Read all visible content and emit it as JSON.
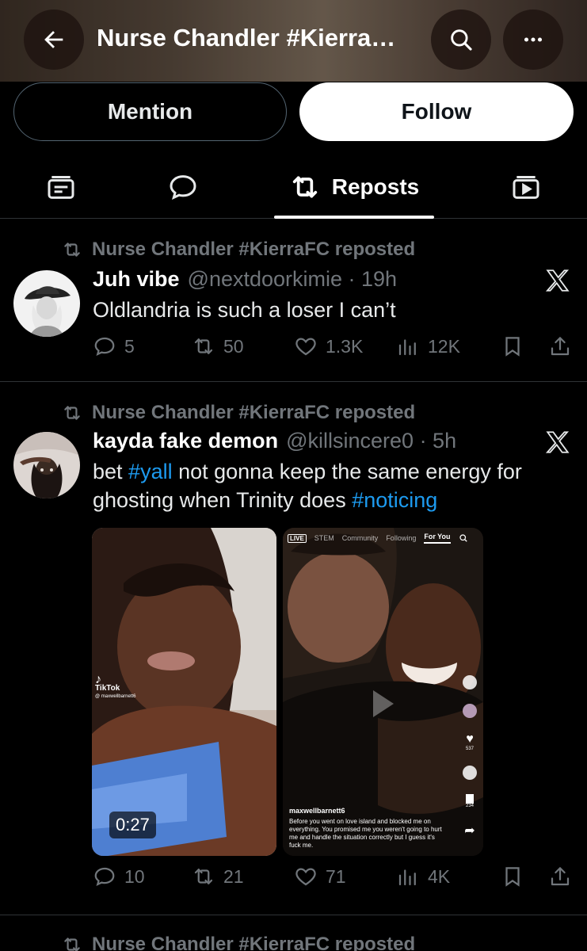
{
  "header": {
    "title": "Nurse Chandler #Kierra…",
    "icons": {
      "back": "arrow-left-icon",
      "search": "search-icon",
      "more": "more-horizontal-icon"
    }
  },
  "actions": {
    "mention": "Mention",
    "follow": "Follow"
  },
  "tabs": [
    {
      "icon": "highlights-icon",
      "label": ""
    },
    {
      "icon": "speech-bubble-icon",
      "label": ""
    },
    {
      "icon": "repost-icon",
      "label": "Reposts",
      "active": true
    },
    {
      "icon": "media-icon",
      "label": ""
    }
  ],
  "posts": [
    {
      "repost_label": "Nurse Chandler #KierraFC reposted",
      "display_name": "Juh vibe",
      "handle_time": "@nextdoorkimie · 19h",
      "text": "Oldlandria is such a loser I can’t",
      "replies": "5",
      "reposts": "50",
      "likes": "1.3K",
      "views": "12K"
    },
    {
      "repost_label": "Nurse Chandler #KierraFC reposted",
      "display_name": "kayda fake demon",
      "handle_time": "@killsincere0 · 5h",
      "text_parts": [
        "bet ",
        "#yall",
        " not gonna keep the same energy for ghosting when Trinity does ",
        "#noticing"
      ],
      "media": [
        {
          "duration": "0:27",
          "watermark": "TikTok",
          "watermark_user": "@ maxwellbarnett6"
        },
        {
          "top_nav": [
            "LIVE",
            "STEM",
            "Community",
            "Following",
            "For You"
          ],
          "caption_user": "maxwellbarnett6",
          "caption": "Before you went on love island and blocked me on everything. You promised me you weren't going to hurt me and handle the situation correctly but I guess it's fuck me.",
          "side_counts": {
            "likes": "537",
            "saves": "234"
          }
        }
      ],
      "replies": "10",
      "reposts": "21",
      "likes": "71",
      "views": "4K"
    },
    {
      "repost_label": "Nurse Chandler #KierraFC reposted"
    }
  ],
  "colors": {
    "background": "#000000",
    "muted": "#71767b",
    "link": "#1d9bf0",
    "divider": "#2f3336"
  }
}
